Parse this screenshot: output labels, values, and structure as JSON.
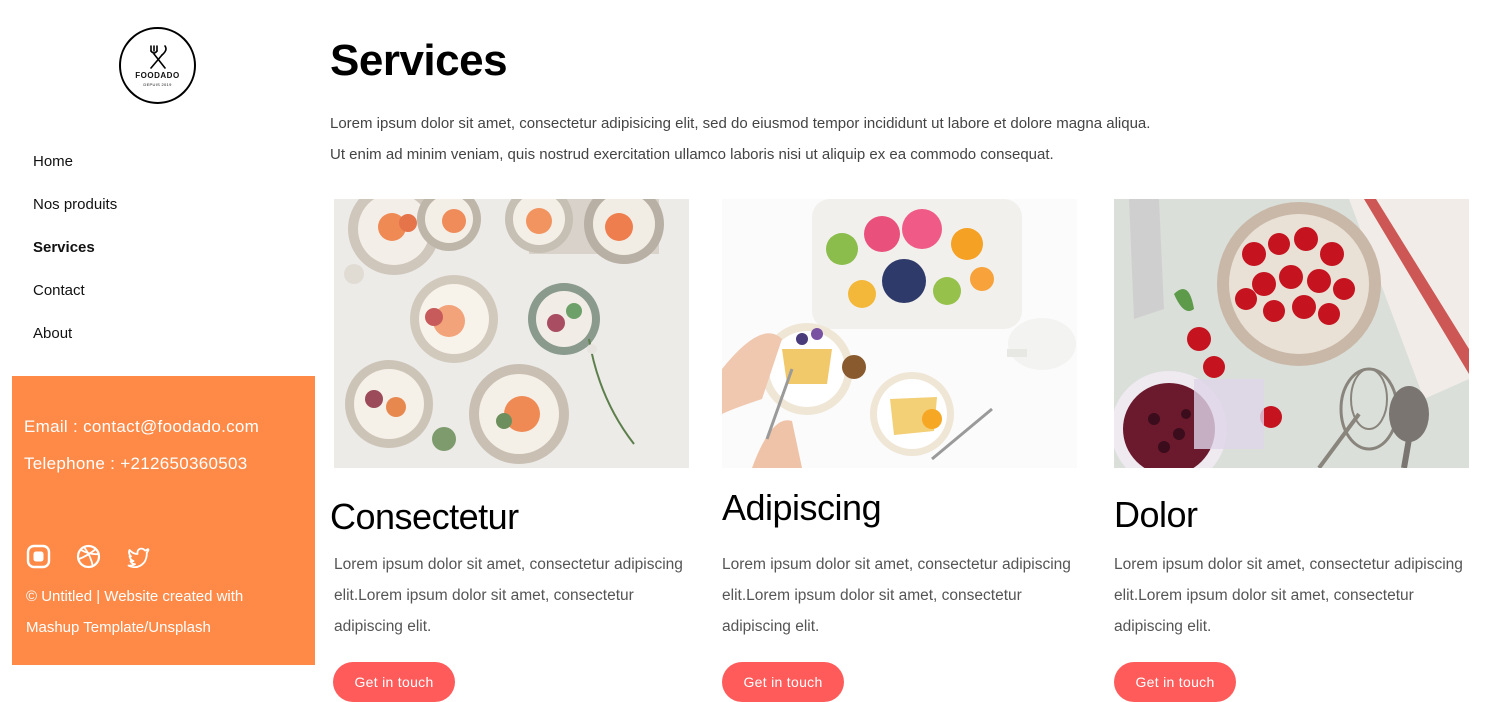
{
  "brand": {
    "name": "FOODADO",
    "since": "DEPUIS 2019",
    "logo_icon": "fork-knife-icon"
  },
  "nav": {
    "items": [
      {
        "label": "Home"
      },
      {
        "label": "Nos produits"
      },
      {
        "label": "Services"
      },
      {
        "label": "Contact"
      },
      {
        "label": "About"
      }
    ],
    "active": "Services"
  },
  "contact": {
    "email": "Email : contact@foodado.com",
    "phone": "Telephone : +212650360503",
    "social_icons": [
      "instagram-icon",
      "dribbble-icon",
      "twitter-icon"
    ],
    "footer_line1": "© Untitled | Website created with",
    "footer_line2": "Mashup Template/Unsplash"
  },
  "main": {
    "title": "Services",
    "intro_line1": "Lorem ipsum dolor sit amet, consectetur adipisicing elit, sed do eiusmod tempor incididunt ut labore et dolore magna aliqua.",
    "intro_line2": "Ut enim ad minim veniam, quis nostrud exercitation ullamco laboris nisi ut aliquip ex ea commodo consequat.",
    "cards": [
      {
        "title": "Consectetur",
        "text": "Lorem ipsum dolor sit amet, consectetur adipiscing elit.Lorem ipsum dolor sit amet, consectetur adipiscing elit.",
        "button": "Get in touch"
      },
      {
        "title": "Adipiscing",
        "text": "Lorem ipsum dolor sit amet, consectetur adipiscing elit.Lorem ipsum dolor sit amet, consectetur adipiscing elit.",
        "button": "Get in touch"
      },
      {
        "title": "Dolor",
        "text": "Lorem ipsum dolor sit amet, consectetur adipiscing elit.Lorem ipsum dolor sit amet, consectetur adipiscing elit.",
        "button": "Get in touch"
      }
    ]
  },
  "colors": {
    "accent_orange": "#ff8a48",
    "button_red": "#ff5b5b",
    "text_dark": "#111111",
    "text_muted": "#555555"
  }
}
